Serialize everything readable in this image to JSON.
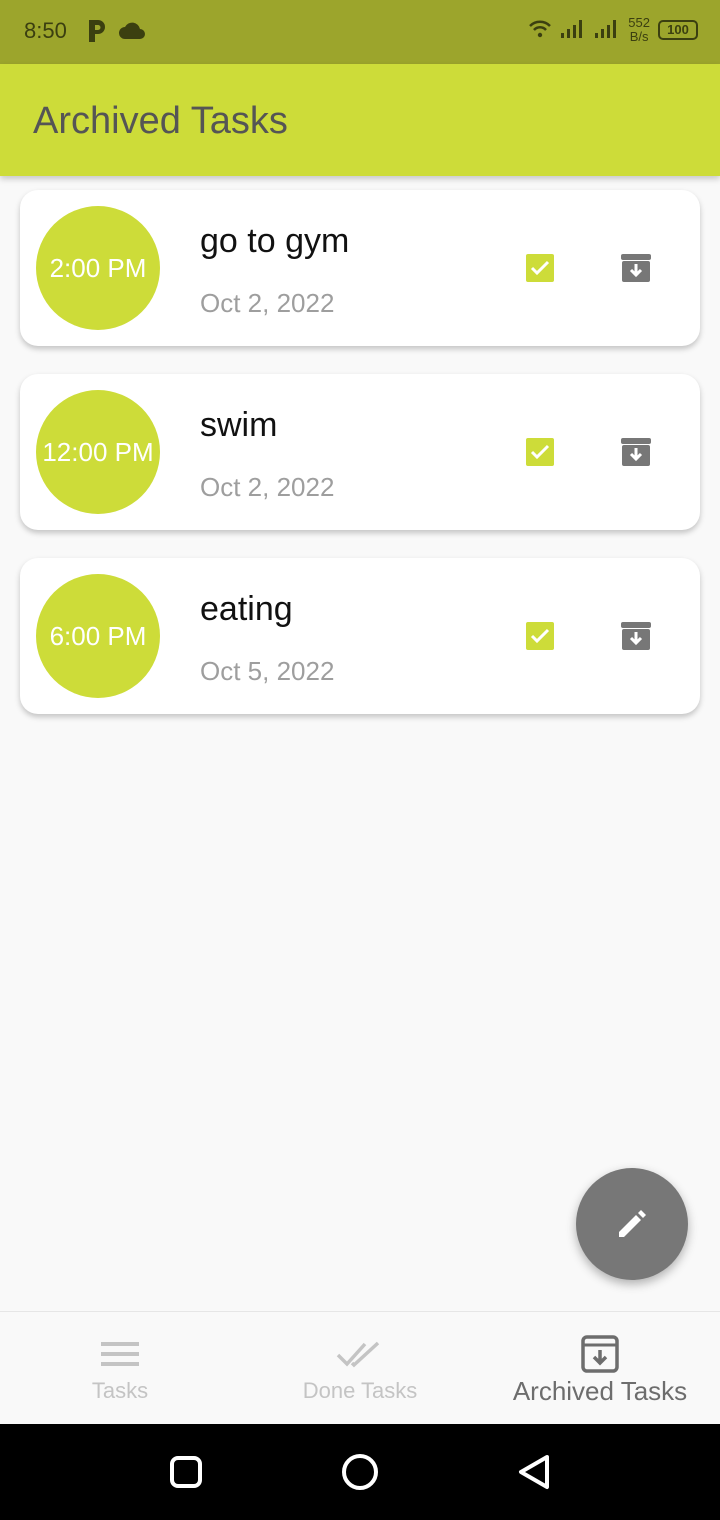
{
  "status_bar": {
    "time": "8:50",
    "net_speed_value": "552",
    "net_speed_unit": "B/s",
    "battery": "100"
  },
  "app_bar": {
    "title": "Archived Tasks"
  },
  "tasks": [
    {
      "time": "2:00 PM",
      "title": "go to gym",
      "date": "Oct 2, 2022"
    },
    {
      "time": "12:00 PM",
      "title": "swim",
      "date": "Oct 2, 2022"
    },
    {
      "time": "6:00 PM",
      "title": "eating",
      "date": "Oct 5, 2022"
    }
  ],
  "bottom_nav": {
    "items": [
      {
        "label": "Tasks",
        "icon": "menu-icon",
        "active": false
      },
      {
        "label": "Done Tasks",
        "icon": "double-check-icon",
        "active": false
      },
      {
        "label": "Archived Tasks",
        "icon": "archive-icon",
        "active": true
      }
    ]
  },
  "colors": {
    "accent": "#cddc39",
    "status_bar": "#9ca52c",
    "fab": "#777777",
    "archive_icon": "#777777"
  }
}
